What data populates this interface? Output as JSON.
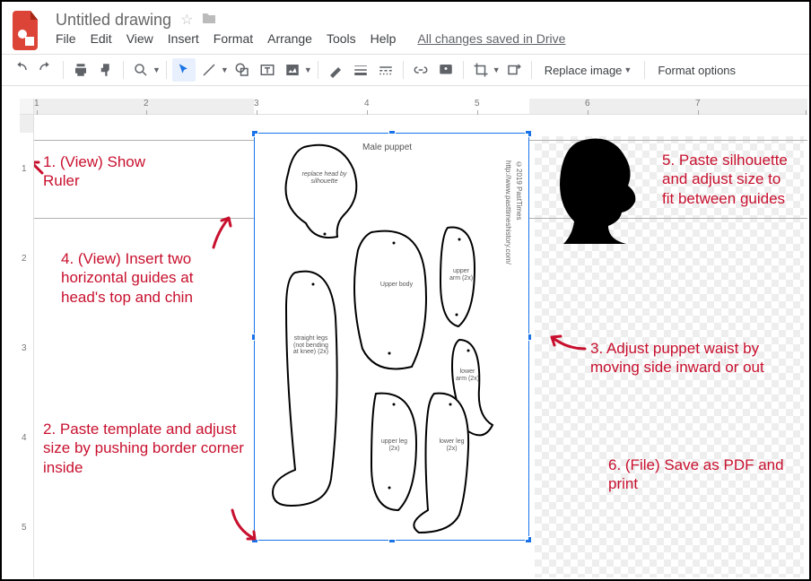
{
  "header": {
    "doc_title": "Untitled drawing",
    "menus": {
      "file": "File",
      "edit": "Edit",
      "view": "View",
      "insert": "Insert",
      "format": "Format",
      "arrange": "Arrange",
      "tools": "Tools",
      "help": "Help"
    },
    "save_status": "All changes saved in Drive"
  },
  "toolbar": {
    "replace_image_label": "Replace image",
    "format_options_label": "Format options"
  },
  "ruler": {
    "h_labels": [
      "1",
      "2",
      "3",
      "4",
      "5",
      "6",
      "7"
    ],
    "v_labels": [
      "1",
      "2",
      "3",
      "4",
      "5"
    ]
  },
  "puppet": {
    "title": "Male puppet",
    "head": "replace head by silhouette",
    "upper_body": "Upper body",
    "upper_arm": "upper arm (2x)",
    "lower_arm": "lower arm (2x)",
    "legs": "straight legs (not bending at knee) (2x)",
    "upper_leg": "upper leg (2x)",
    "lower_leg": "lower leg (2x)",
    "copyright": "©2019 PastTimes",
    "url": "http://www.pasttimeshistory.com/"
  },
  "annotations": {
    "a1": "1. (View) Show Ruler",
    "a2": "2. Paste template and adjust size by pushing border corner inside",
    "a3": "3. Adjust puppet waist by moving side inward or out",
    "a4": "4. (View) Insert two horizontal guides at head's top and chin",
    "a5": "5. Paste silhouette and adjust size to fit between guides",
    "a6": "6. (File) Save as PDF and print"
  }
}
